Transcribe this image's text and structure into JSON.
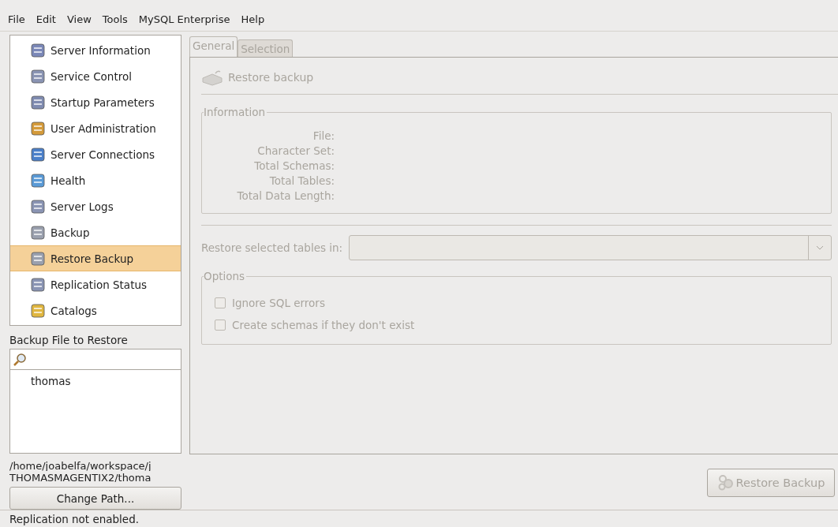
{
  "menu": [
    "File",
    "Edit",
    "View",
    "Tools",
    "MySQL Enterprise",
    "Help"
  ],
  "nav": [
    {
      "label": "Server Information",
      "selected": false
    },
    {
      "label": "Service Control",
      "selected": false
    },
    {
      "label": "Startup Parameters",
      "selected": false
    },
    {
      "label": "User Administration",
      "selected": false
    },
    {
      "label": "Server Connections",
      "selected": false
    },
    {
      "label": "Health",
      "selected": false
    },
    {
      "label": "Server Logs",
      "selected": false
    },
    {
      "label": "Backup",
      "selected": false
    },
    {
      "label": "Restore Backup",
      "selected": true
    },
    {
      "label": "Replication Status",
      "selected": false
    },
    {
      "label": "Catalogs",
      "selected": false
    }
  ],
  "backup_files": {
    "title": "Backup File to Restore",
    "items": [
      "thomas"
    ],
    "path_lines": [
      "/home/joabelfa/workspace/j",
      "THOMASMAGENTIX2/thoma"
    ],
    "change_button": "Change Path..."
  },
  "tabs": [
    {
      "label": "General",
      "selected": true
    },
    {
      "label": "Selection",
      "selected": false
    }
  ],
  "heading": "Restore backup",
  "information": {
    "title": "Information",
    "fields": [
      "File:",
      "Character Set:",
      "Total Schemas:",
      "Total Tables:",
      "Total Data Length:"
    ]
  },
  "restore_in": {
    "label": "Restore selected tables in:",
    "disabled": true
  },
  "options": {
    "title": "Options",
    "items": [
      {
        "label": "Ignore SQL errors",
        "checked": false,
        "disabled": true
      },
      {
        "label": "Create schemas if they don't exist",
        "checked": false,
        "disabled": true
      }
    ]
  },
  "restore_button": {
    "label": "Restore Backup",
    "disabled": true
  },
  "status_bar": "Replication not enabled."
}
